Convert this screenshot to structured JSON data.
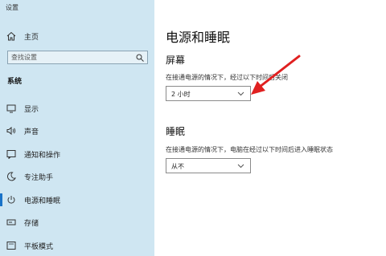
{
  "window": {
    "title": "设置"
  },
  "sidebar": {
    "home_label": "主页",
    "search_placeholder": "查找设置",
    "section_label": "系统",
    "items": [
      {
        "label": "显示",
        "icon": "monitor-icon"
      },
      {
        "label": "声音",
        "icon": "speaker-icon"
      },
      {
        "label": "通知和操作",
        "icon": "notification-icon"
      },
      {
        "label": "专注助手",
        "icon": "moon-icon"
      },
      {
        "label": "电源和睡眠",
        "icon": "power-icon",
        "active": true
      },
      {
        "label": "存储",
        "icon": "storage-icon"
      },
      {
        "label": "平板模式",
        "icon": "tablet-icon"
      }
    ]
  },
  "main": {
    "title": "电源和睡眠",
    "screen": {
      "heading": "屏幕",
      "description": "在接通电源的情况下，经过以下时间后关闭",
      "selected": "2 小时"
    },
    "sleep": {
      "heading": "睡眠",
      "description": "在接通电源的情况下，电脑在经过以下时间后进入睡眠状态",
      "selected": "从不"
    }
  },
  "colors": {
    "sidebar_bg": "#cfe6f2",
    "accent": "#1a73c8",
    "annotation_arrow": "#e02020"
  }
}
